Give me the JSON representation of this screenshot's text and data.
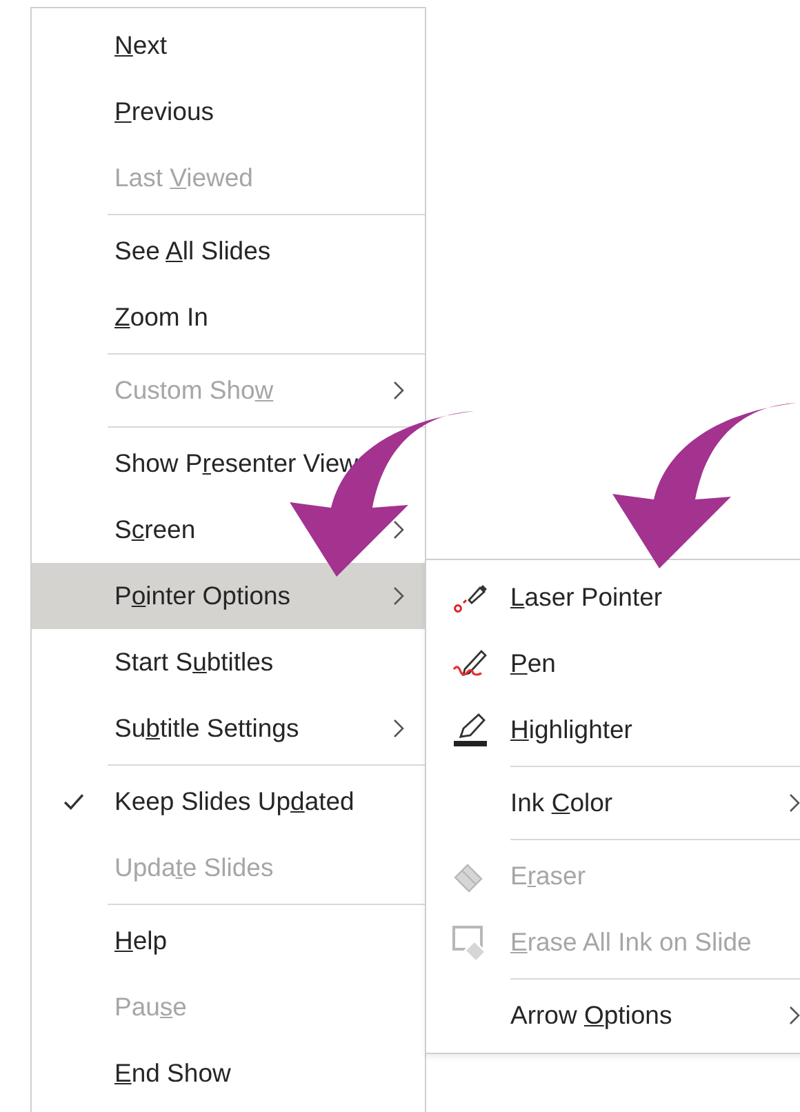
{
  "main_menu": {
    "items": [
      {
        "kind": "item",
        "label": {
          "key": "N",
          "after": "ext"
        },
        "disabled": false
      },
      {
        "kind": "item",
        "label": {
          "key": "P",
          "after": "revious"
        },
        "disabled": false
      },
      {
        "kind": "item",
        "label": {
          "before": "Last ",
          "key": "V",
          "after": "iewed"
        },
        "disabled": true
      },
      {
        "kind": "separator"
      },
      {
        "kind": "item",
        "label": {
          "before": "See ",
          "key": "A",
          "after": "ll Slides"
        },
        "disabled": false
      },
      {
        "kind": "item",
        "label": {
          "key": "Z",
          "after": "oom In"
        },
        "disabled": false
      },
      {
        "kind": "separator"
      },
      {
        "kind": "item",
        "label": {
          "before": "Custom Sho",
          "key": "w"
        },
        "disabled": true,
        "submenu": true
      },
      {
        "kind": "separator"
      },
      {
        "kind": "item",
        "label": {
          "before": "Show P",
          "key": "r",
          "after": "esenter View"
        },
        "disabled": false
      },
      {
        "kind": "item",
        "label": {
          "before": "S",
          "key": "c",
          "after": "reen"
        },
        "disabled": false,
        "submenu": true
      },
      {
        "kind": "item",
        "label": {
          "before": "P",
          "key": "o",
          "after": "inter Options"
        },
        "disabled": false,
        "submenu": true,
        "selected": true
      },
      {
        "kind": "item",
        "label": {
          "before": "Start S",
          "key": "u",
          "after": "btitles"
        },
        "disabled": false
      },
      {
        "kind": "item",
        "label": {
          "before": "Su",
          "key": "b",
          "after": "title Settings"
        },
        "disabled": false,
        "submenu": true
      },
      {
        "kind": "separator"
      },
      {
        "kind": "item",
        "label": {
          "before": "Keep Slides Up",
          "key": "d",
          "after": "ated"
        },
        "disabled": false,
        "checked": true
      },
      {
        "kind": "item",
        "label": {
          "before": "Upda",
          "key": "t",
          "after": "e Slides"
        },
        "disabled": true
      },
      {
        "kind": "separator"
      },
      {
        "kind": "item",
        "label": {
          "key": "H",
          "after": "elp"
        },
        "disabled": false
      },
      {
        "kind": "item",
        "label": {
          "before": "Pau",
          "key": "s",
          "after": "e"
        },
        "disabled": true
      },
      {
        "kind": "item",
        "label": {
          "key": "E",
          "after": "nd Show"
        },
        "disabled": false
      }
    ]
  },
  "pointer_submenu": {
    "items": [
      {
        "kind": "item",
        "label": {
          "key": "L",
          "after": "aser Pointer"
        },
        "disabled": false
      },
      {
        "kind": "item",
        "label": {
          "key": "P",
          "after": "en"
        },
        "disabled": false
      },
      {
        "kind": "item",
        "label": {
          "key": "H",
          "after": "ighlighter"
        },
        "disabled": false
      },
      {
        "kind": "separator"
      },
      {
        "kind": "item",
        "label": {
          "before": "Ink ",
          "key": "C",
          "after": "olor"
        },
        "disabled": false,
        "submenu": true
      },
      {
        "kind": "separator"
      },
      {
        "kind": "item",
        "label": {
          "before": "E",
          "key": "r",
          "after": "aser"
        },
        "disabled": true
      },
      {
        "kind": "item",
        "label": {
          "key": "E",
          "after": "rase All Ink on Slide"
        },
        "disabled": true
      },
      {
        "kind": "separator"
      },
      {
        "kind": "item",
        "label": {
          "before": "Arrow ",
          "key": "O",
          "after": "ptions"
        },
        "disabled": false,
        "submenu": true
      }
    ]
  }
}
